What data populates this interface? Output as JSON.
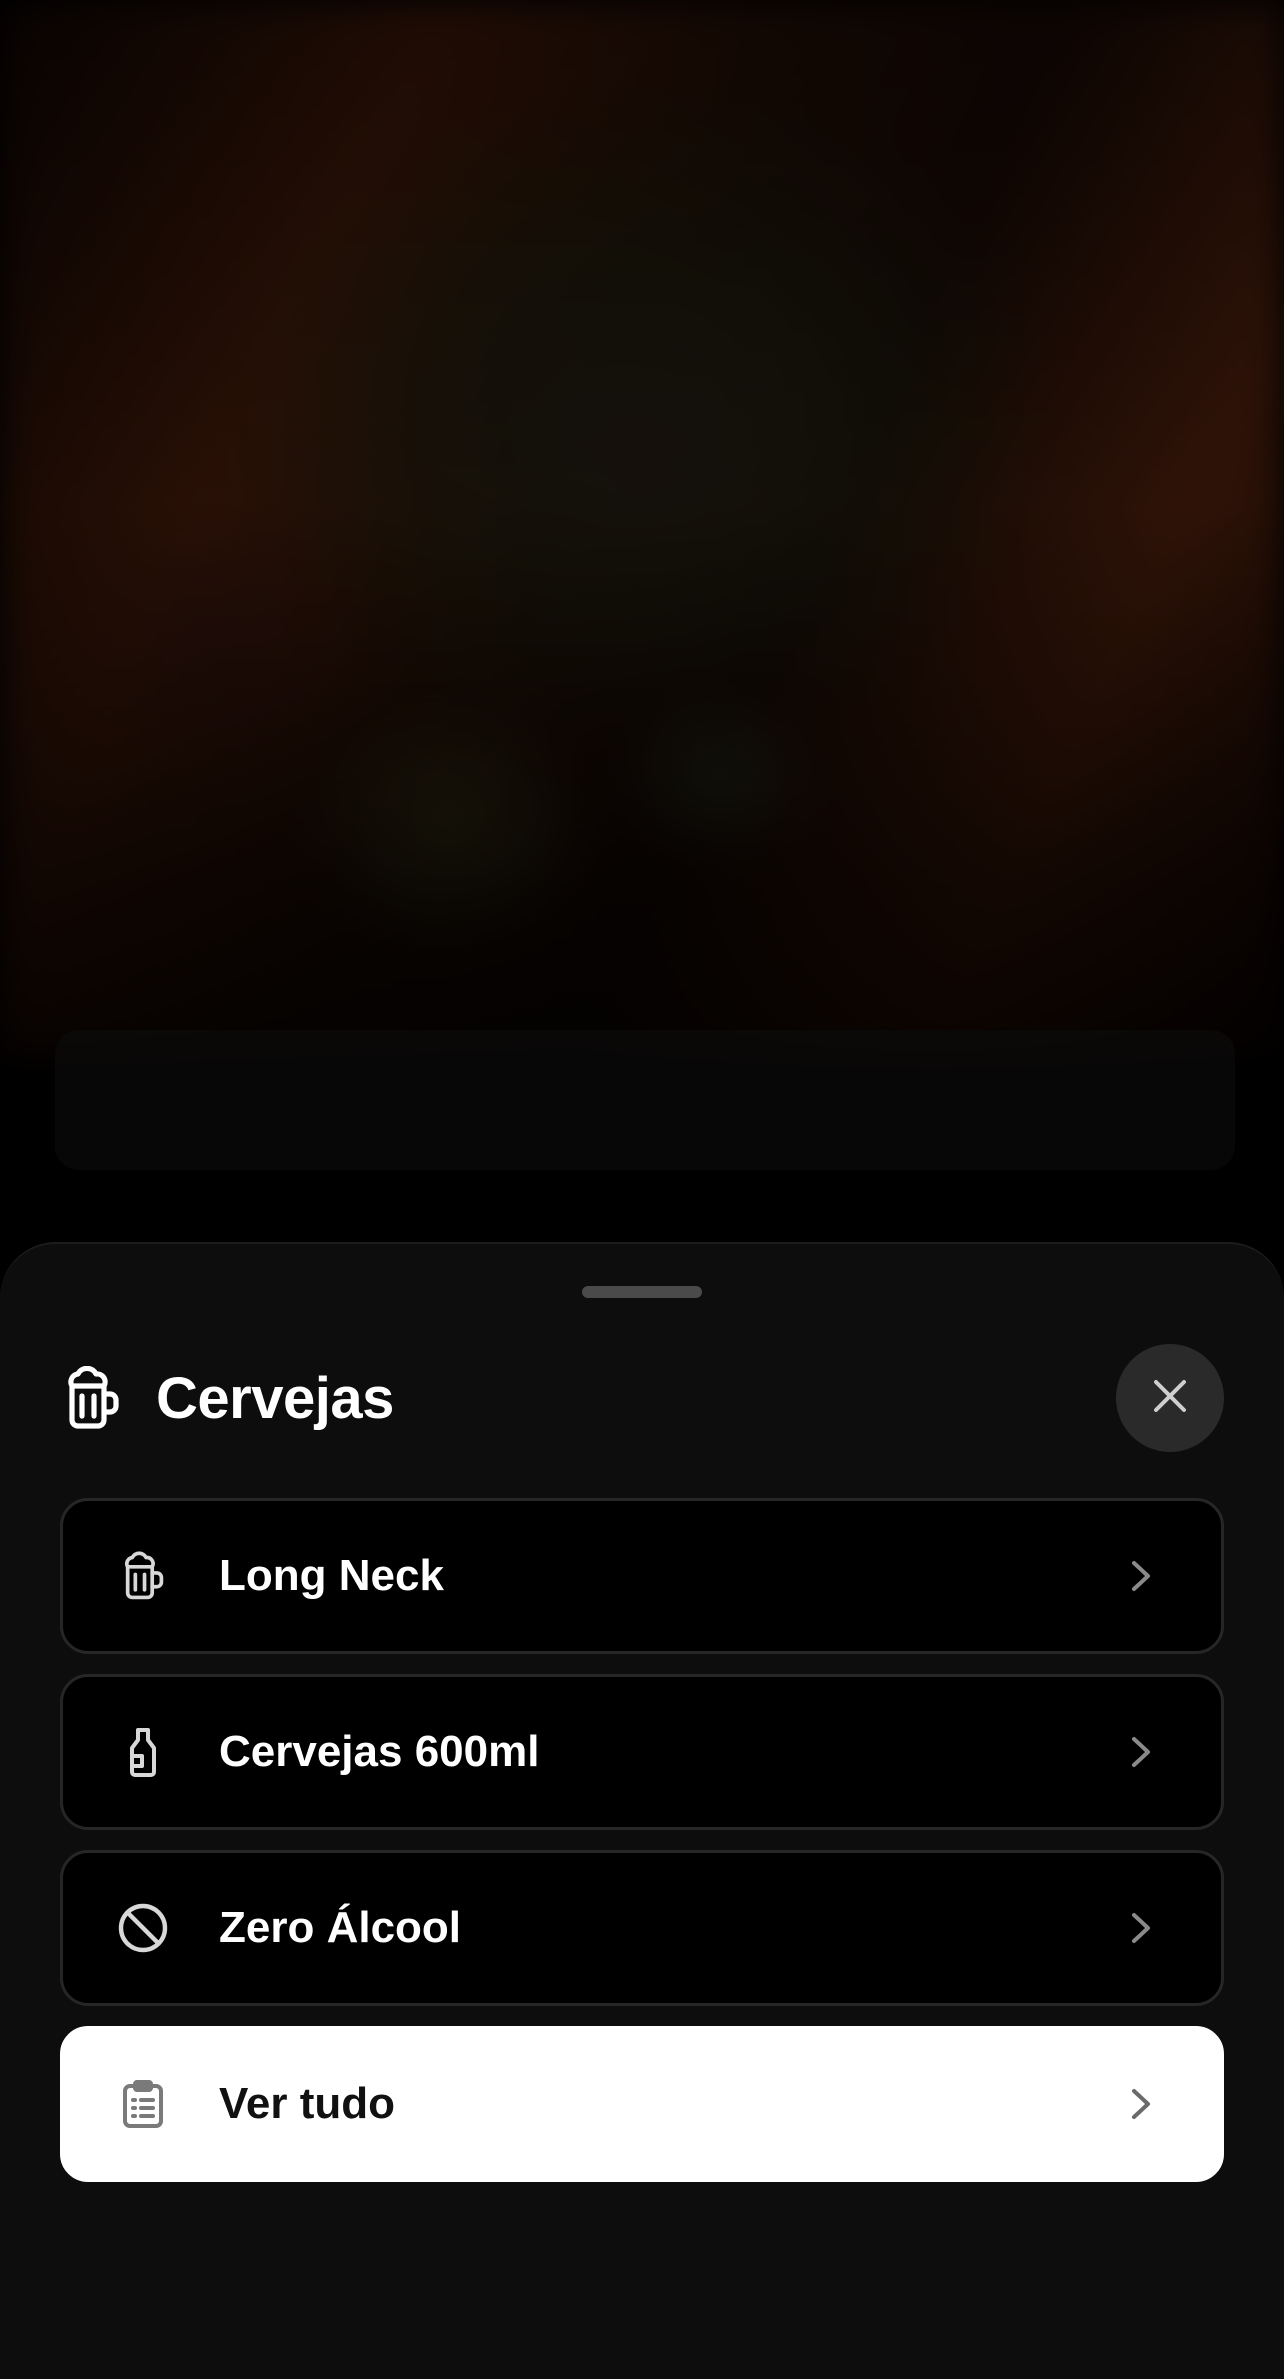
{
  "sheet": {
    "title": "Cervejas",
    "title_icon": "beer-mug-icon",
    "close_icon": "close-icon"
  },
  "items": [
    {
      "label": "Long Neck",
      "icon": "beer-mug-icon"
    },
    {
      "label": "Cervejas 600ml",
      "icon": "bottle-icon"
    },
    {
      "label": "Zero Álcool",
      "icon": "prohibited-icon"
    },
    {
      "label": "Ver tudo",
      "icon": "clipboard-list-icon",
      "primary": true
    }
  ],
  "colors": {
    "sheet_background": "#0d0d0d",
    "item_background": "#000000",
    "primary_item_background": "#ffffff",
    "close_button_background": "#2a2a2a"
  }
}
